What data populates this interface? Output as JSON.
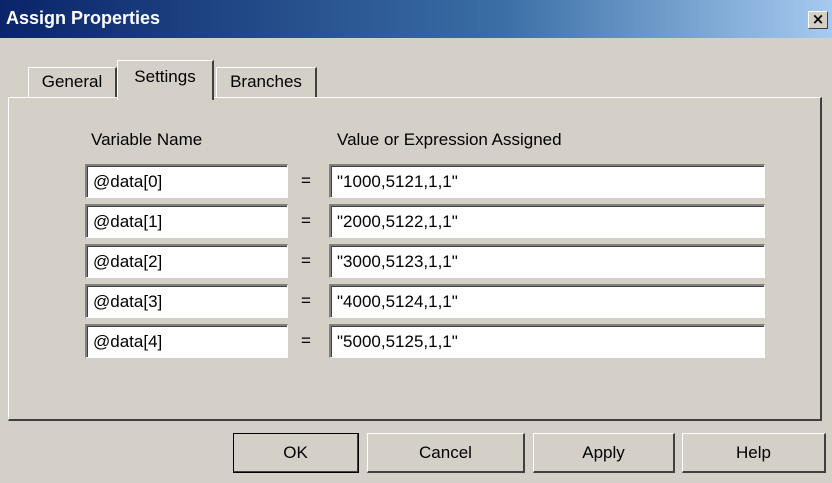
{
  "window": {
    "title": "Assign Properties",
    "close_glyph": "×"
  },
  "tabs": [
    {
      "label": "General",
      "active": false
    },
    {
      "label": "Settings",
      "active": true
    },
    {
      "label": "Branches",
      "active": false
    }
  ],
  "columns": {
    "variable": "Variable Name",
    "value": "Value or Expression Assigned"
  },
  "assignments": [
    {
      "variable": "@data[0]",
      "equals": "=",
      "value": "\"1000,5121,1,1\""
    },
    {
      "variable": "@data[1]",
      "equals": "=",
      "value": "\"2000,5122,1,1\""
    },
    {
      "variable": "@data[2]",
      "equals": "=",
      "value": "\"3000,5123,1,1\""
    },
    {
      "variable": "@data[3]",
      "equals": "=",
      "value": "\"4000,5124,1,1\""
    },
    {
      "variable": "@data[4]",
      "equals": "=",
      "value": "\"5000,5125,1,1\""
    }
  ],
  "buttons": {
    "ok": "OK",
    "cancel": "Cancel",
    "apply": "Apply",
    "help": "Help"
  },
  "colors": {
    "face": "#d4d0c8",
    "title_start": "#0a246a",
    "title_end": "#a6caf0"
  }
}
